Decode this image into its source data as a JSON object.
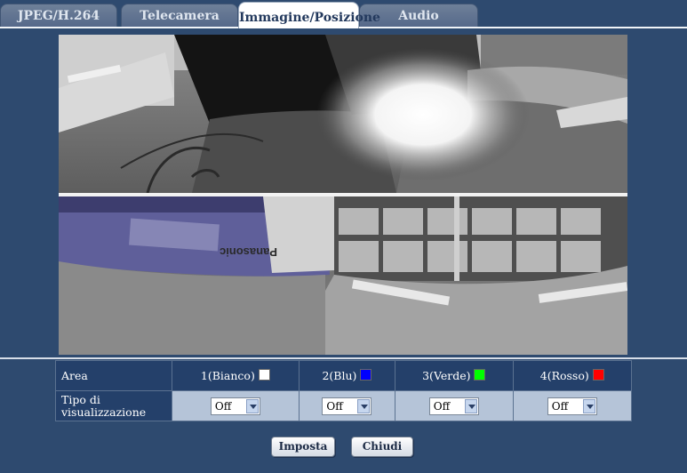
{
  "tabs": [
    {
      "label": "JPEG/H.264",
      "active": false
    },
    {
      "label": "Telecamera",
      "active": false
    },
    {
      "label": "Immagine/Posizione",
      "active": true
    },
    {
      "label": "Audio",
      "active": false
    }
  ],
  "camera_image": {
    "text": "Panasonic"
  },
  "area_table": {
    "header_label": "Area",
    "areas": [
      {
        "label": "1(Bianco)",
        "color": "#ffffff",
        "value": "Off"
      },
      {
        "label": "2(Blu)",
        "color": "#0000ff",
        "value": "Off"
      },
      {
        "label": "3(Verde)",
        "color": "#00ff00",
        "value": "Off"
      },
      {
        "label": "4(Rosso)",
        "color": "#ff0000",
        "value": "Off"
      }
    ],
    "type_label": "Tipo di visualizzazione"
  },
  "buttons": {
    "set": "Imposta",
    "close": "Chiudi"
  }
}
